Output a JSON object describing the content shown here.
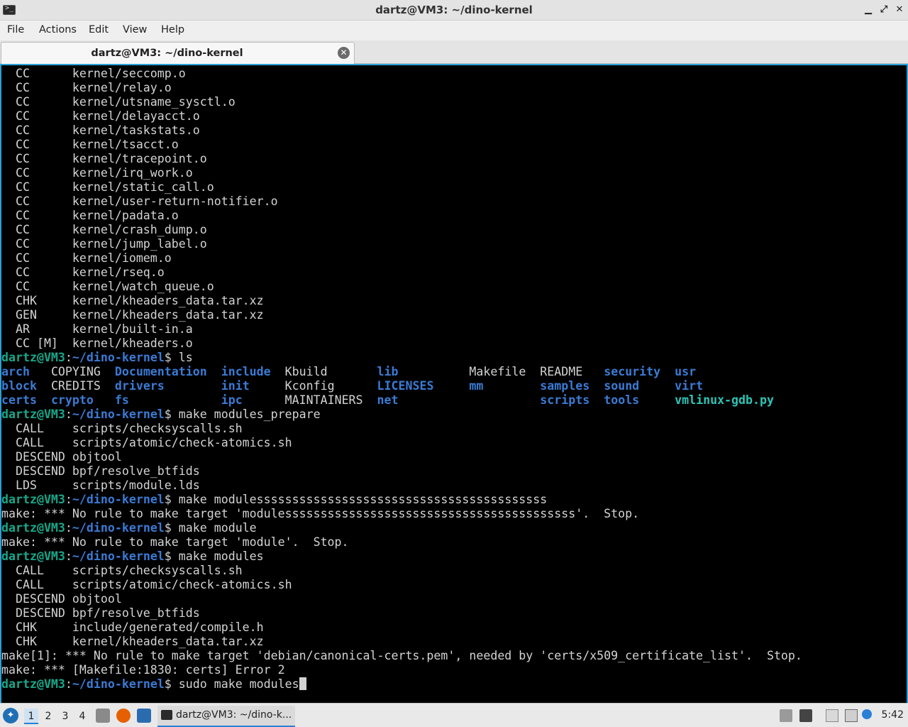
{
  "window": {
    "title": "dartz@VM3: ~/dino-kernel",
    "icon_glyph": ">_",
    "controls": {
      "minimize": "▁",
      "maximize": "⤢",
      "close": "✕"
    }
  },
  "menu": [
    "File",
    "Actions",
    "Edit",
    "View",
    "Help"
  ],
  "tab": {
    "label": "dartz@VM3: ~/dino-kernel",
    "close": "✕"
  },
  "prompt": {
    "user": "dartz@VM3",
    "path": "~/dino-kernel"
  },
  "terminal": {
    "build_lines_1": [
      "  CC      kernel/seccomp.o",
      "  CC      kernel/relay.o",
      "  CC      kernel/utsname_sysctl.o",
      "  CC      kernel/delayacct.o",
      "  CC      kernel/taskstats.o",
      "  CC      kernel/tsacct.o",
      "  CC      kernel/tracepoint.o",
      "  CC      kernel/irq_work.o",
      "  CC      kernel/static_call.o",
      "  CC      kernel/user-return-notifier.o",
      "  CC      kernel/padata.o",
      "  CC      kernel/crash_dump.o",
      "  CC      kernel/jump_label.o",
      "  CC      kernel/iomem.o",
      "  CC      kernel/rseq.o",
      "  CC      kernel/watch_queue.o",
      "  CHK     kernel/kheaders_data.tar.xz",
      "  GEN     kernel/kheaders_data.tar.xz",
      "  AR      kernel/built-in.a",
      "  CC [M]  kernel/kheaders.o"
    ],
    "cmd_ls": "ls",
    "ls_rows": [
      [
        {
          "t": "arch",
          "k": "dir"
        },
        {
          "t": "COPYING",
          "k": "file"
        },
        {
          "t": "Documentation",
          "k": "dir"
        },
        {
          "t": "include",
          "k": "dir"
        },
        {
          "t": "Kbuild",
          "k": "file"
        },
        {
          "t": "lib",
          "k": "dir"
        },
        {
          "t": "Makefile",
          "k": "file"
        },
        {
          "t": "README",
          "k": "file"
        },
        {
          "t": "security",
          "k": "dir"
        },
        {
          "t": "usr",
          "k": "dir"
        }
      ],
      [
        {
          "t": "block",
          "k": "dir"
        },
        {
          "t": "CREDITS",
          "k": "file"
        },
        {
          "t": "drivers",
          "k": "dir"
        },
        {
          "t": "init",
          "k": "dir"
        },
        {
          "t": "Kconfig",
          "k": "file"
        },
        {
          "t": "LICENSES",
          "k": "dir"
        },
        {
          "t": "mm",
          "k": "dir"
        },
        {
          "t": "samples",
          "k": "dir"
        },
        {
          "t": "sound",
          "k": "dir"
        },
        {
          "t": "virt",
          "k": "dir"
        }
      ],
      [
        {
          "t": "certs",
          "k": "dir"
        },
        {
          "t": "crypto",
          "k": "dir"
        },
        {
          "t": "fs",
          "k": "dir"
        },
        {
          "t": "ipc",
          "k": "dir"
        },
        {
          "t": "MAINTAINERS",
          "k": "file"
        },
        {
          "t": "net",
          "k": "dir"
        },
        {
          "t": "",
          "k": "file"
        },
        {
          "t": "scripts",
          "k": "dir"
        },
        {
          "t": "tools",
          "k": "dir"
        },
        {
          "t": "vmlinux-gdb.py",
          "k": "exe"
        }
      ]
    ],
    "cmd_prepare": "make modules_prepare",
    "prepare_lines": [
      "  CALL    scripts/checksyscalls.sh",
      "  CALL    scripts/atomic/check-atomics.sh",
      "  DESCEND objtool",
      "  DESCEND bpf/resolve_btfids",
      "  LDS     scripts/module.lds"
    ],
    "cmd_typo": "make modulesssssssssssssssssssssssssssssssssssssssss",
    "err_typo": "make: *** No rule to make target 'modulesssssssssssssssssssssssssssssssssssssssss'.  Stop.",
    "cmd_module": "make module",
    "err_module": "make: *** No rule to make target 'module'.  Stop.",
    "cmd_modules": "make modules",
    "modules_lines": [
      "  CALL    scripts/checksyscalls.sh",
      "  CALL    scripts/atomic/check-atomics.sh",
      "  DESCEND objtool",
      "  DESCEND bpf/resolve_btfids",
      "  CHK     include/generated/compile.h",
      "  CHK     kernel/kheaders_data.tar.xz"
    ],
    "err_certs_1": "make[1]: *** No rule to make target 'debian/canonical-certs.pem', needed by 'certs/x509_certificate_list'.  Stop.",
    "err_certs_2": "make: *** [Makefile:1830: certs] Error 2",
    "cmd_current": "sudo make modules"
  },
  "taskbar": {
    "workspaces": [
      "1",
      "2",
      "3",
      "4"
    ],
    "active_task": "dartz@VM3: ~/dino-k...",
    "clock": "5:42",
    "colors": {
      "accent": "#2a9fd6",
      "prompt_user": "#17a88a",
      "prompt_path": "#3a7bd5"
    }
  }
}
